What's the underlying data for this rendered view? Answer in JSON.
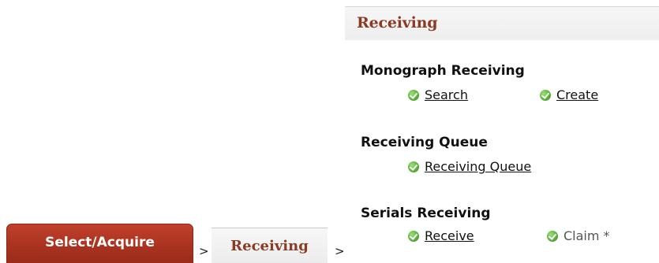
{
  "panel": {
    "title": "Receiving",
    "sections": [
      {
        "title": "Monograph Receiving",
        "links": [
          {
            "label": "Search",
            "icon": "check-circle-icon"
          },
          {
            "label": "Create",
            "icon": "check-circle-icon"
          }
        ]
      },
      {
        "title": "Receiving Queue",
        "links": [
          {
            "label": "Receiving Queue",
            "icon": "check-circle-icon"
          }
        ]
      },
      {
        "title": "Serials Receiving",
        "links": [
          {
            "label": "Receive",
            "icon": "check-circle-icon"
          },
          {
            "label": "Claim *",
            "icon": "check-circle-icon"
          }
        ]
      }
    ]
  },
  "breadcrumb": {
    "tab1": "Select/Acquire",
    "separator": ">",
    "tab2": "Receiving"
  },
  "colors": {
    "tab_active": "#a8321f",
    "header_text": "#8b3a23",
    "check_green": "#5cb33a"
  }
}
